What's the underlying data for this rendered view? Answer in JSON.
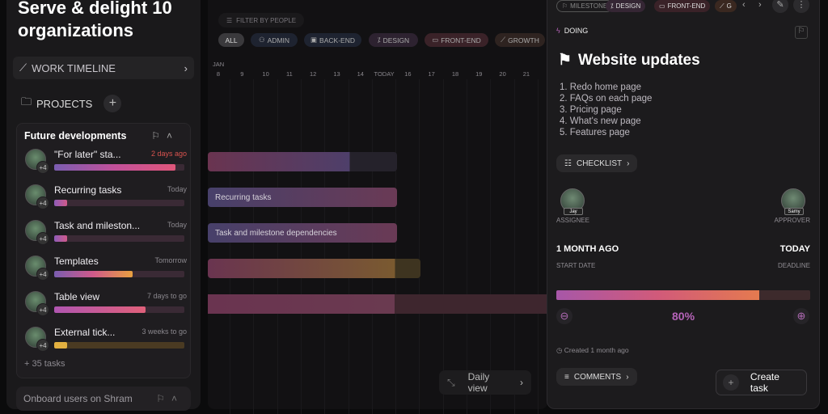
{
  "goal_title": "Serve & delight 10 organizations",
  "work_timeline": "WORK TIMELINE",
  "projects_label": "PROJECTS",
  "project": {
    "name": "Future developments",
    "tasks": [
      {
        "name": "\"For later\" sta...",
        "due": "2 days ago",
        "progress": 0.93,
        "overdue": true,
        "avatar_extra": "+4"
      },
      {
        "name": "Recurring tasks",
        "due": "Today",
        "progress": 0.1,
        "avatar_extra": "+4"
      },
      {
        "name": "Task and mileston...",
        "due": "Today",
        "progress": 0.1,
        "avatar_extra": "+4"
      },
      {
        "name": "Templates",
        "due": "Tomorrow",
        "progress": 0.6,
        "avatar_extra": "+4"
      },
      {
        "name": "Table view",
        "due": "7 days to go",
        "progress": 0.7,
        "avatar_extra": "+4"
      },
      {
        "name": "External tick...",
        "due": "3 weeks to go",
        "progress": 0.1,
        "avatar_extra": "+4"
      }
    ],
    "more": "+ 35 tasks"
  },
  "project2": {
    "name": "Onboard users on Shram"
  },
  "timeline": {
    "filter": "FILTER BY PEOPLE",
    "tags": [
      "ALL",
      "ADMIN",
      "BACK-END",
      "DESIGN",
      "FRONT-END",
      "GROWTH"
    ],
    "month": "JAN",
    "days": [
      "8",
      "9",
      "10",
      "11",
      "12",
      "13",
      "14",
      "TODAY",
      "16",
      "17",
      "18",
      "19",
      "20",
      "21"
    ],
    "bars": [
      {
        "label": ""
      },
      {
        "label": "Recurring tasks"
      },
      {
        "label": "Task and milestone dependencies"
      },
      {
        "label": ""
      },
      {
        "label": ""
      }
    ],
    "view": "Daily view"
  },
  "detail": {
    "tags": [
      "MILESTONE",
      "DESIGN",
      "FRONT-END",
      "G"
    ],
    "status": "DOING",
    "title": "Website updates",
    "items": [
      "1. Redo home page",
      "2. FAQs on each page",
      "3. Pricing page",
      "4. What's new page",
      "5. Features page"
    ],
    "checklist": "CHECKLIST",
    "assignee": {
      "name": "Jay",
      "label": "ASSIGNEE"
    },
    "approver": {
      "name": "Samy",
      "label": "APPROVER"
    },
    "start": {
      "value": "1 MONTH AGO",
      "label": "START DATE"
    },
    "deadline": {
      "value": "TODAY",
      "label": "DEADLINE"
    },
    "progress": 80,
    "progress_text": "80%",
    "created": "Created 1 month ago",
    "comments": "COMMENTS",
    "create_task": "Create task"
  },
  "colors": {
    "accent": "#b563b8",
    "overdue": "#d9534f"
  }
}
